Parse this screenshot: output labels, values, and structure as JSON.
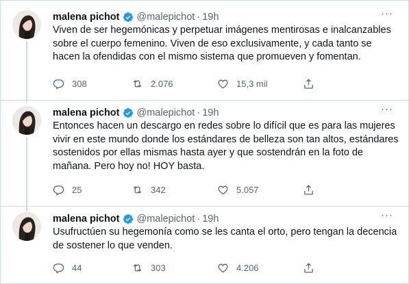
{
  "author": {
    "name": "malena pichot",
    "handle": "@malepichot",
    "verified": true,
    "avatar_icon": "avatar-photo"
  },
  "tweets": [
    {
      "time": "19h",
      "text": "Viven de ser hegemónicas y perpetuar imágenes mentirosas e inalcanzables sobre el cuerpo femenino. Viven de eso exclusivamente, y cada tanto se hacen la ofendidas con el mismo sistema que promueven y fomentan.",
      "replies": "308",
      "retweets": "2.076",
      "likes": "15,3 mil"
    },
    {
      "time": "19h",
      "text": "Entonces hacen un descargo en redes sobre lo difícil que es para las mujeres vivir en este mundo donde los estándares de belleza son tan altos, estándares sostenidos por ellas mismas hasta ayer y que sostendrán en la foto de mañana. Pero hoy no! HOY basta.",
      "replies": "25",
      "retweets": "342",
      "likes": "5.057"
    },
    {
      "time": "19h",
      "text": "Usufructúen su hegemonía como se les canta el orto, pero tengan la decencia de sostener lo que venden.",
      "replies": "44",
      "retweets": "303",
      "likes": "4.206"
    }
  ],
  "ui": {
    "more_label": "···",
    "separator": "·"
  },
  "colors": {
    "verified_badge": "#1d9bf0",
    "secondary_text": "#536471",
    "divider": "#cfd9de"
  }
}
